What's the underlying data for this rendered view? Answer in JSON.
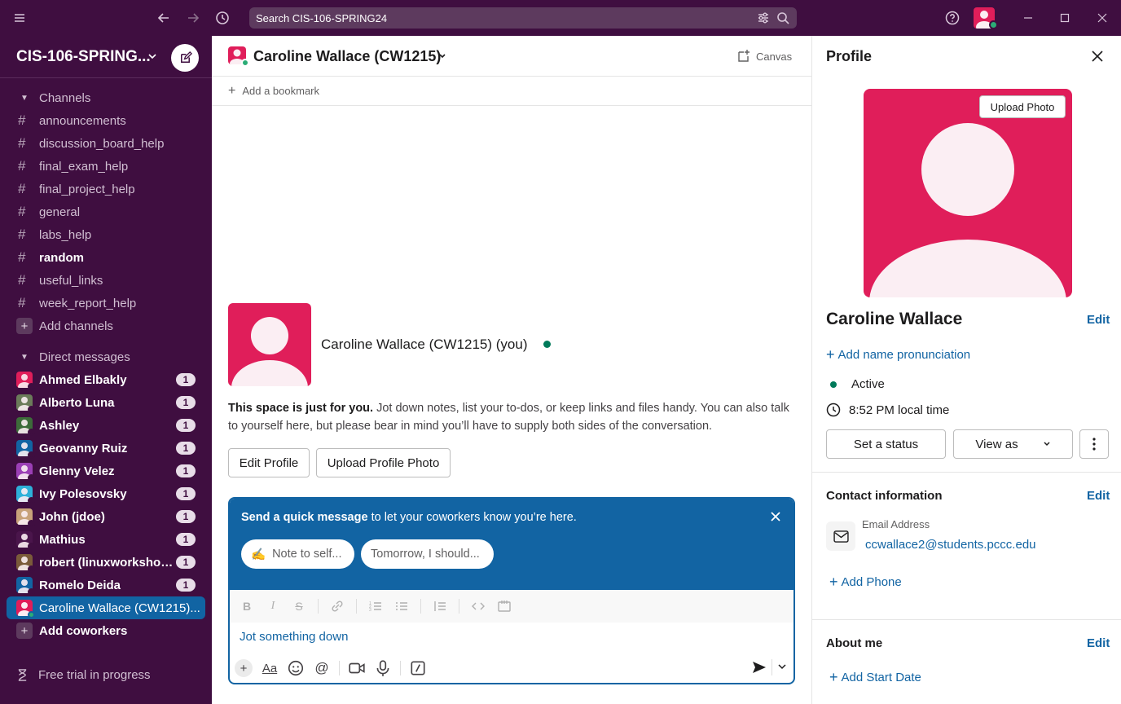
{
  "topbar": {
    "search_placeholder": "Search CIS-106-SPRING24"
  },
  "sidebar": {
    "workspace": "CIS-106-SPRING...",
    "channels_header": "Channels",
    "channels": [
      {
        "name": "announcements",
        "bold": false
      },
      {
        "name": "discussion_board_help",
        "bold": false
      },
      {
        "name": "final_exam_help",
        "bold": false
      },
      {
        "name": "final_project_help",
        "bold": false
      },
      {
        "name": "general",
        "bold": false
      },
      {
        "name": "labs_help",
        "bold": false
      },
      {
        "name": "random",
        "bold": true
      },
      {
        "name": "useful_links",
        "bold": false
      },
      {
        "name": "week_report_help",
        "bold": false
      }
    ],
    "add_channels": "Add channels",
    "dm_header": "Direct messages",
    "dms": [
      {
        "name": "Ahmed Elbakly",
        "badge": "1",
        "color": "#e01e5a"
      },
      {
        "name": "Alberto Luna",
        "badge": "1",
        "color": "#6b7b5a"
      },
      {
        "name": "Ashley",
        "badge": "1",
        "color": "#3d6b3a"
      },
      {
        "name": "Geovanny Ruiz",
        "badge": "1",
        "color": "#1264a3"
      },
      {
        "name": "Glenny Velez",
        "badge": "1",
        "color": "#9b3fb5"
      },
      {
        "name": "Ivy Polesovsky",
        "badge": "1",
        "color": "#2eb0d9"
      },
      {
        "name": "John (jdoe)",
        "badge": "1",
        "color": "#c8a27a"
      },
      {
        "name": "Mathius",
        "badge": "1",
        "color": "#4a154b"
      },
      {
        "name": "robert (linuxworkshop...",
        "badge": "1",
        "color": "#7a5a3a"
      },
      {
        "name": "Romelo Deida",
        "badge": "1",
        "color": "#1264a3"
      }
    ],
    "active_dm": "Caroline Wallace (CW1215)...",
    "add_coworkers": "Add coworkers",
    "trial": "Free trial in progress"
  },
  "channel": {
    "title": "Caroline Wallace (CW1215)",
    "canvas": "Canvas",
    "add_bookmark": "Add a bookmark",
    "intro_name": "Caroline Wallace (CW1215) (you)",
    "intro_bold": "This space is just for you.",
    "intro_rest": " Jot down notes, list your to-dos, or keep links and files handy. You can also talk to yourself here, but please bear in mind you’ll have to supply both sides of the conversation.",
    "edit_profile": "Edit Profile",
    "upload_profile_photo": "Upload Profile Photo",
    "quick_bold": "Send a quick message",
    "quick_rest": " to let your coworkers know you’re here.",
    "chip1_emoji": "✍️",
    "chip1": "Note to self...",
    "chip2": "Tomorrow, I should...",
    "composer_placeholder": "Jot something down"
  },
  "profile": {
    "title": "Profile",
    "upload_photo": "Upload Photo",
    "name": "Caroline Wallace",
    "edit": "Edit",
    "add_pronunciation": "Add name pronunciation",
    "status": "Active",
    "local_time": "8:52 PM local time",
    "set_status": "Set a status",
    "view_as": "View as",
    "contact_header": "Contact information",
    "email_label": "Email Address",
    "email": "ccwallace2@students.pccc.edu",
    "add_phone": "Add Phone",
    "about_header": "About me",
    "add_start_date": "Add Start Date"
  }
}
